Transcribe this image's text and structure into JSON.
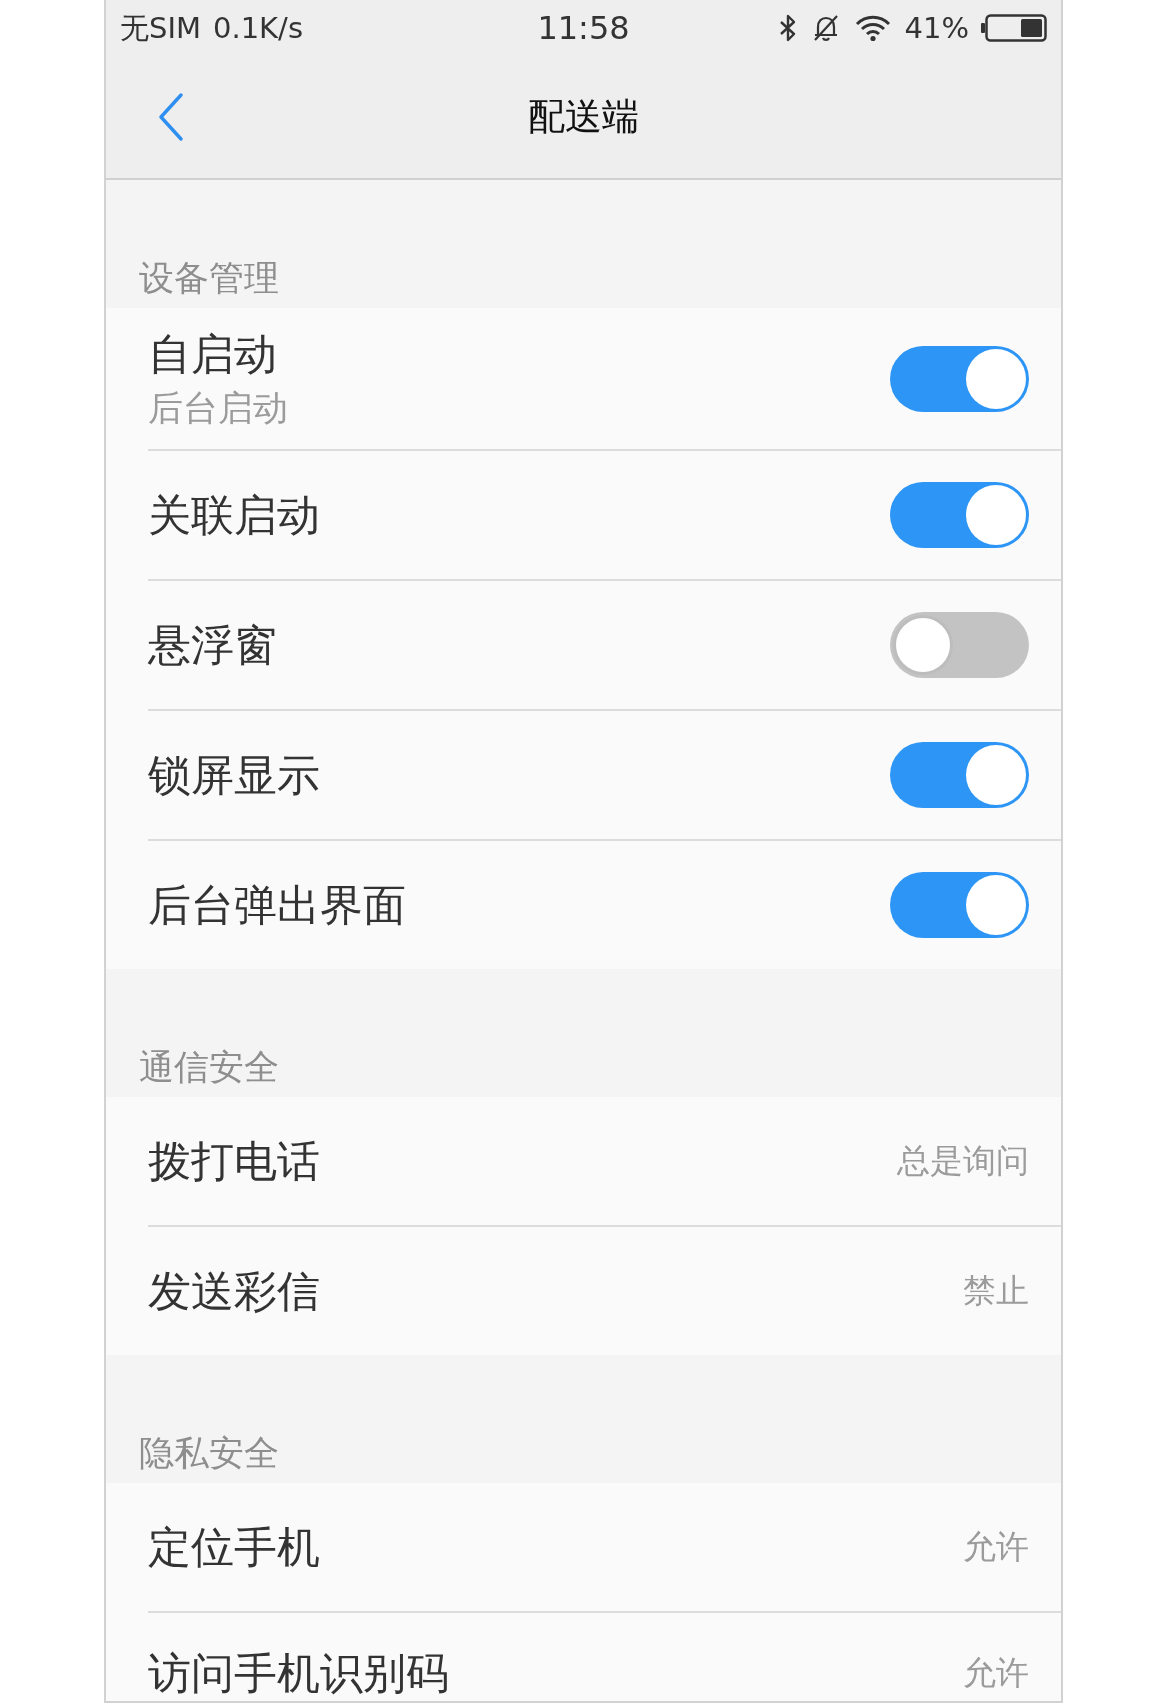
{
  "status_bar": {
    "carrier": "无SIM",
    "network_speed": "0.1K/s",
    "time": "11:58",
    "battery_percent": "41%"
  },
  "nav_bar": {
    "title": "配送端"
  },
  "sections": [
    {
      "title": "设备管理",
      "items": [
        {
          "kind": "toggle",
          "label": "自启动",
          "description": "后台启动",
          "on": true
        },
        {
          "kind": "toggle",
          "label": "关联启动",
          "on": true
        },
        {
          "kind": "toggle",
          "label": "悬浮窗",
          "on": false
        },
        {
          "kind": "toggle",
          "label": "锁屏显示",
          "on": true
        },
        {
          "kind": "toggle",
          "label": "后台弹出界面",
          "on": true
        }
      ]
    },
    {
      "title": "通信安全",
      "items": [
        {
          "kind": "value",
          "label": "拨打电话",
          "value": "总是询问"
        },
        {
          "kind": "value",
          "label": "发送彩信",
          "value": "禁止"
        }
      ]
    },
    {
      "title": "隐私安全",
      "items": [
        {
          "kind": "value",
          "label": "定位手机",
          "value": "允许"
        },
        {
          "kind": "value",
          "label": "访问手机识别码",
          "value": "允许"
        }
      ]
    }
  ]
}
